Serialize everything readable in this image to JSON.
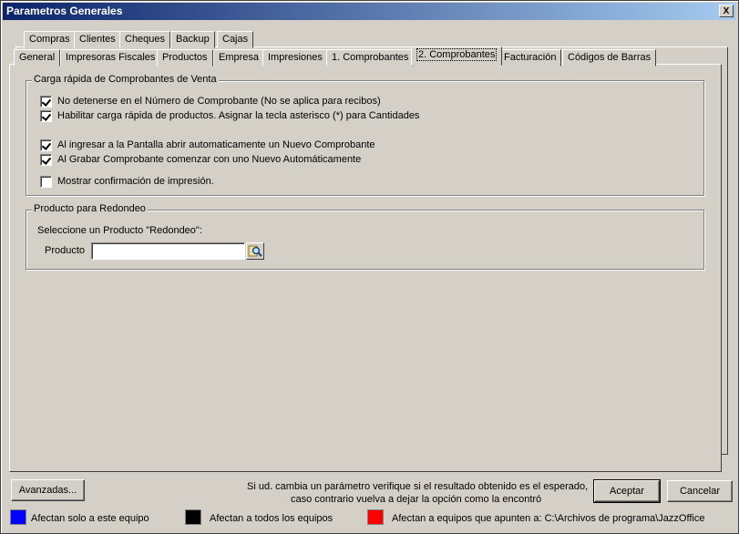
{
  "window": {
    "title": "Parametros Generales",
    "close_label": "X"
  },
  "tabs_row1": [
    "Compras",
    "Clientes",
    "Cheques",
    "Backup",
    "Cajas"
  ],
  "tabs_row2": [
    "General",
    "Impresoras Fiscales",
    "Productos",
    "Empresa",
    "Impresiones",
    "1. Comprobantes",
    "2. Comprobantes",
    "Facturación",
    "Códigos de Barras"
  ],
  "active_tab": "2. Comprobantes",
  "carga_group": {
    "title": "Carga rápida de Comprobantes de Venta",
    "options": [
      {
        "label": "No detenerse en el Número de Comprobante  (No se aplica para recibos)",
        "checked": true
      },
      {
        "label": "Habilitar carga rápida de productos. Asignar la tecla asterisco (*) para Cantidades",
        "checked": true
      },
      {
        "label": "Al ingresar a la Pantalla abrir automaticamente un Nuevo Comprobante",
        "checked": true
      },
      {
        "label": "Al Grabar Comprobante comenzar con uno Nuevo Automáticamente",
        "checked": true
      },
      {
        "label": "Mostrar confirmación de impresión.",
        "checked": false
      }
    ]
  },
  "redondeo_group": {
    "title": "Producto para Redondeo",
    "instruction": "Seleccione un Producto \"Redondeo\":",
    "field_label": "Producto",
    "field_value": ""
  },
  "footer": {
    "advanced_label": "Avanzadas...",
    "notice_line1": "Si ud. cambia un parámetro verifique si el resultado obtenido es el esperado,",
    "notice_line2": "caso contrario vuelva a dejar la opción como la encontró",
    "accept_label": "Aceptar",
    "cancel_label": "Cancelar"
  },
  "legend": [
    {
      "color": "#0000ff",
      "label": "Afectan solo a este equipo"
    },
    {
      "color": "#000000",
      "label": "Afectan a todos los equipos"
    },
    {
      "color": "#ff0000",
      "label": "Afectan a equipos que apunten a: C:\\Archivos de programa\\JazzOffice"
    }
  ]
}
